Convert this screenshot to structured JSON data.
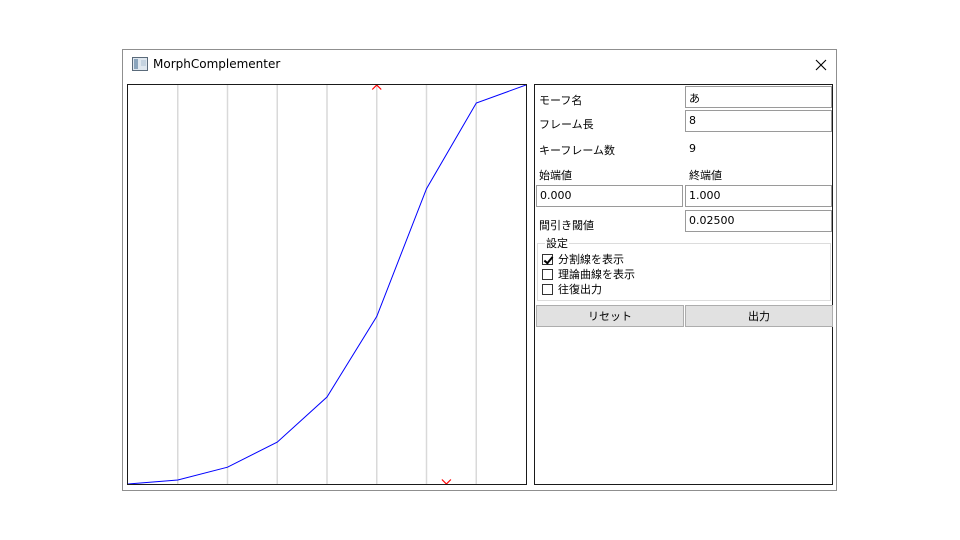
{
  "window": {
    "title": "MorphComplementer"
  },
  "chart_data": {
    "type": "line",
    "xlim": [
      0,
      8
    ],
    "ylim": [
      0,
      1
    ],
    "x": [
      0,
      1,
      2,
      3,
      4,
      5,
      6,
      7,
      8
    ],
    "values": [
      0.0,
      0.01,
      0.042,
      0.105,
      0.218,
      0.42,
      0.74,
      0.955,
      1.0
    ],
    "series_color": "#0000ff",
    "gridline_color": "#d9d9d9",
    "marker_color": "#ff0000",
    "top_marker_x": 5.0,
    "bottom_marker_x": 6.4
  },
  "panel": {
    "morph_name_label": "モーフ名",
    "morph_name_value": "あ",
    "frame_length_label": "フレーム長",
    "frame_length_value": "8",
    "keyframe_count_label": "キーフレーム数",
    "keyframe_count_value": "9",
    "start_value_label": "始端値",
    "end_value_label": "終端値",
    "start_value": "0.000",
    "end_value": "1.000",
    "threshold_label": "間引き閾値",
    "threshold_value": "0.02500",
    "settings_title": "設定",
    "options": [
      {
        "label": "分割線を表示",
        "checked": true
      },
      {
        "label": "理論曲線を表示",
        "checked": false
      },
      {
        "label": "往復出力",
        "checked": false
      }
    ],
    "reset_label": "リセット",
    "output_label": "出力"
  }
}
